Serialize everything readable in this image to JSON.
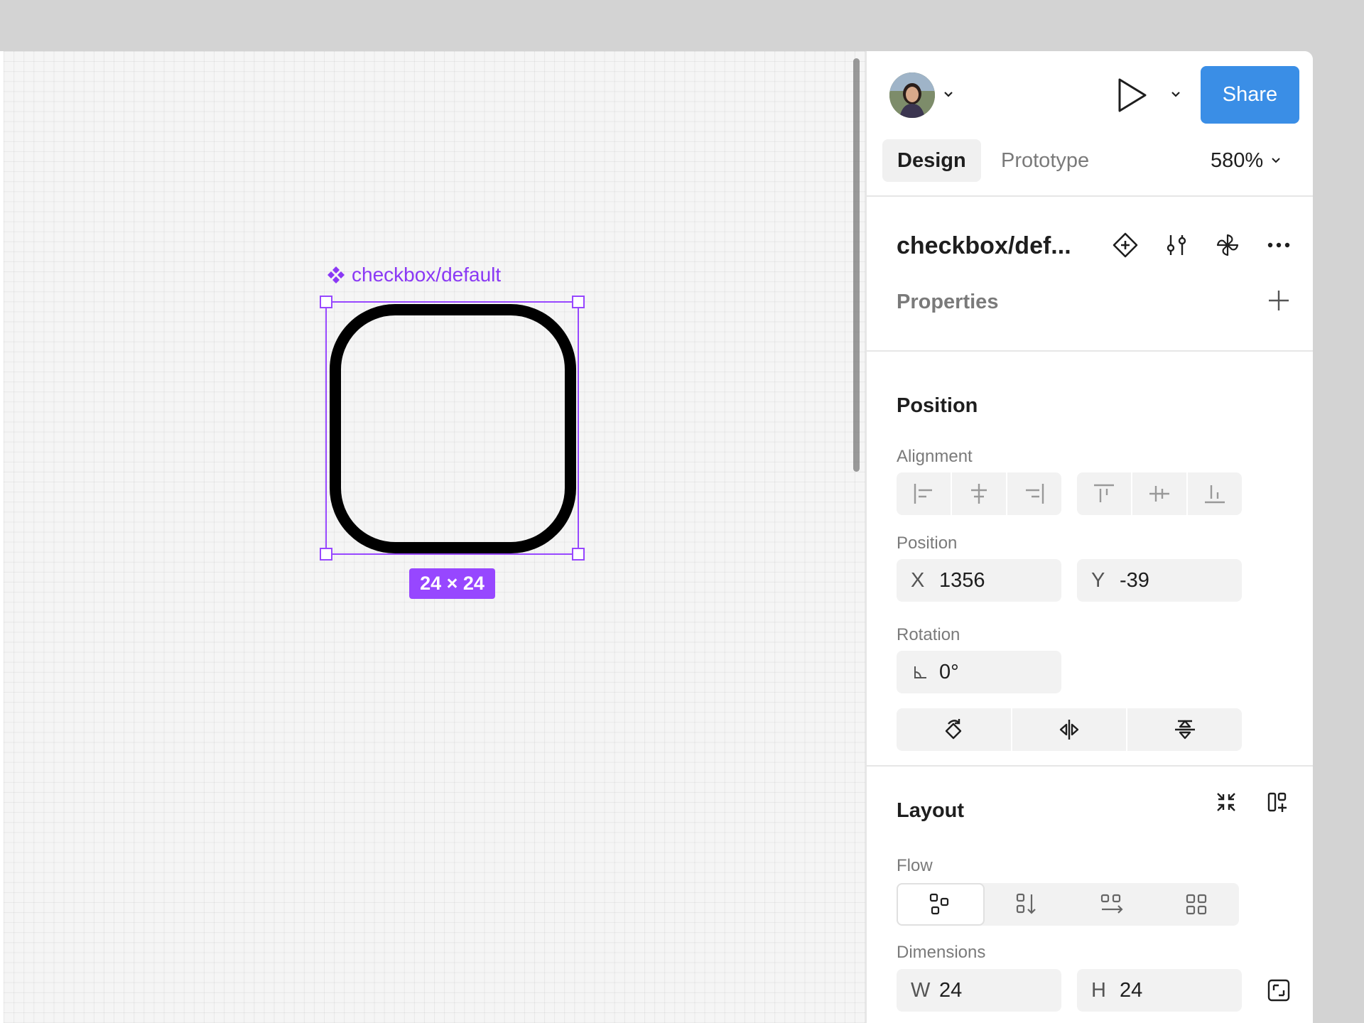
{
  "canvas": {
    "frame_label": "checkbox/default",
    "size_badge": "24 × 24"
  },
  "header": {
    "share_label": "Share",
    "tabs": [
      {
        "label": "Design",
        "active": true
      },
      {
        "label": "Prototype",
        "active": false
      }
    ],
    "zoom": "580%"
  },
  "component": {
    "title": "checkbox/def...",
    "properties_label": "Properties"
  },
  "position": {
    "section_title": "Position",
    "alignment_label": "Alignment",
    "position_label": "Position",
    "x_label": "X",
    "x_value": "1356",
    "y_label": "Y",
    "y_value": "-39",
    "rotation_label": "Rotation",
    "rotation_value": "0°"
  },
  "layout": {
    "section_title": "Layout",
    "flow_label": "Flow",
    "dimensions_label": "Dimensions",
    "w_label": "W",
    "w_value": "24",
    "h_label": "H",
    "h_value": "24"
  },
  "colors": {
    "selection": "#9747ff",
    "share_button": "#3a8ee6",
    "label_purple": "#8a38f5"
  }
}
